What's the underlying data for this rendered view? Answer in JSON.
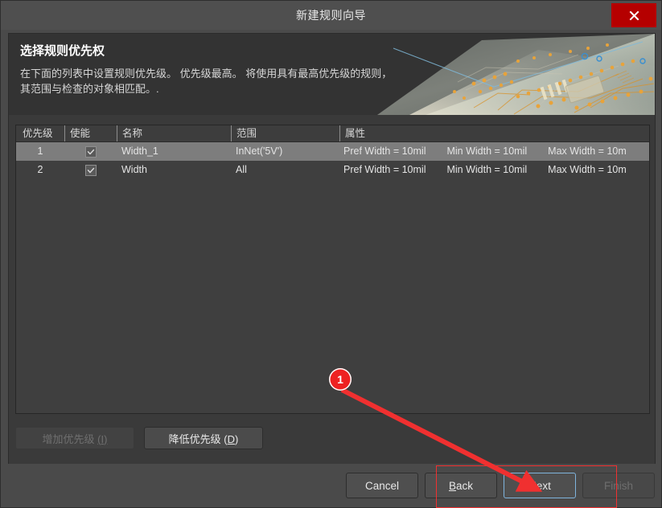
{
  "window": {
    "title": "新建规则向导",
    "close_label": "×"
  },
  "banner": {
    "title": "选择规则优先权",
    "description": "在下面的列表中设置规则优先级。 优先级最高。 将使用具有最高优先级的规则，其范围与检查的对象相匹配。.",
    "image_alt": "pcb-circuit-board-photo"
  },
  "table": {
    "columns": [
      "优先级",
      "使能",
      "名称",
      "范围",
      "属性"
    ],
    "rows": [
      {
        "priority": "1",
        "enabled": true,
        "name": "Width_1",
        "scope": "InNet('5V')",
        "attributes": [
          "Pref Width = 10mil",
          "Min Width = 10mil",
          "Max Width = 10m"
        ],
        "selected": true
      },
      {
        "priority": "2",
        "enabled": true,
        "name": "Width",
        "scope": "All",
        "attributes": [
          "Pref Width = 10mil",
          "Min Width = 10mil",
          "Max Width = 10m"
        ],
        "selected": false
      }
    ]
  },
  "priority_actions": {
    "increase": {
      "text": "增加优先级 ",
      "accel": "(I)",
      "disabled": true
    },
    "decrease": {
      "text": "降低优先级 ",
      "accel_prefix": "(",
      "accel_key": "D",
      "accel_suffix": ")",
      "disabled": false
    }
  },
  "footer": {
    "cancel": "Cancel",
    "back_prefix": "",
    "back_key": "B",
    "back_suffix": "ack",
    "next_prefix": "",
    "next_key": "N",
    "next_suffix": "ext",
    "finish": "Finish"
  },
  "annotations": {
    "step_badge": "1",
    "highlight_target": "next-button"
  },
  "colors": {
    "accent_close": "#b50000",
    "annotation_red": "#ee2222",
    "focus_blue": "#7fb4dd",
    "selected_row": "#7d7d7d"
  }
}
